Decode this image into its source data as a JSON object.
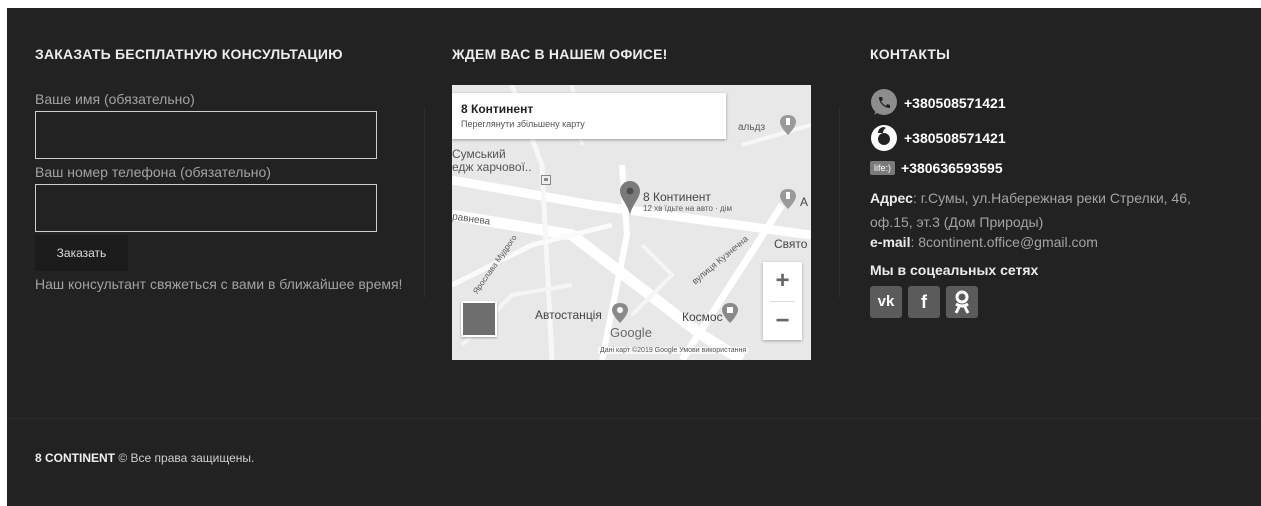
{
  "form": {
    "title": "ЗАКАЗАТЬ БЕСПЛАТНУЮ КОНСУЛЬТАЦИЮ",
    "name_label": "Ваше имя (обязательно)",
    "name_value": "",
    "phone_label": "Ваш номер телефона (обязательно)",
    "phone_value": "",
    "submit_label": "Заказать",
    "note": "Наш консультант свяжеться с вами в ближайшее время!"
  },
  "office": {
    "title": "ЖДЕМ ВАС В НАШЕМ ОФИСЕ!",
    "map": {
      "card_title": "8 Континент",
      "card_link": "Переглянути збільшену карту",
      "labels": [
        "альдз",
        "Сумський",
        "едж харчової..",
        "8 Континент",
        "12 хв їдьте на авто · дім",
        "Свято",
        "равнева",
        "Ярослава Мудрого",
        "вулиця Кузнечна",
        "Автостанція",
        "Космос",
        "А"
      ],
      "logo": "Google",
      "attribution": "Дані карт ©2019 Google   Умови використання",
      "zoom_in": "+",
      "zoom_out": "−"
    }
  },
  "contacts": {
    "title": "КОНТАКТЫ",
    "phones": [
      {
        "icon": "kyivstar-phone-icon",
        "number": "+380508571421"
      },
      {
        "icon": "vodafone-icon",
        "number": "+380508571421"
      },
      {
        "icon": "life-icon",
        "icon_text": "life:)",
        "number": "+380636593595"
      }
    ],
    "address_label": "Адрес",
    "address_value": ": г.Сумы, ул.Набережная реки Стрелки, 46, оф.15, эт.3 (Дом Природы)",
    "email_label": "e-mail",
    "email_value": ": 8continent.office@gmail.com",
    "social_title": "Мы в соцеальных сетях",
    "social": [
      {
        "name": "vk-icon",
        "text": "vk"
      },
      {
        "name": "facebook-icon",
        "text": "f"
      },
      {
        "name": "odnoklassniki-icon",
        "text": ""
      }
    ]
  },
  "copyright": {
    "brand": "8 CONTINENT",
    "text": " © Все права защищены."
  }
}
